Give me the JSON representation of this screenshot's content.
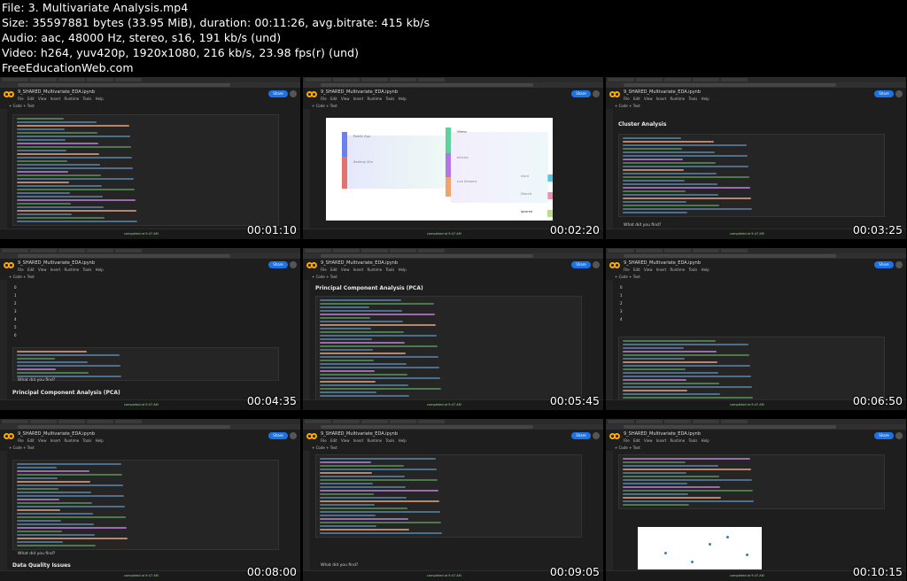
{
  "header": {
    "file": "File: 3. Multivariate Analysis.mp4",
    "size": "Size: 35597881 bytes (33.95 MiB), duration: 00:11:26, avg.bitrate: 415 kb/s",
    "audio": "Audio: aac, 48000 Hz, stereo, s16, 191 kb/s (und)",
    "video": "Video: h264, yuv420p, 1920x1080, 216 kb/s, 23.98 fps(r) (und)",
    "site": "FreeEducationWeb.com"
  },
  "colab": {
    "file_name": "9_SHARED_Multivariate_EDA.ipynb",
    "menu": "File Edit View Insert Runtime Tools Help",
    "share": "Share",
    "toolbar": "+ Code + Text",
    "status": "completed at 9:47 AM"
  },
  "thumbnails": [
    {
      "timestamp": "00:01:10",
      "section": ""
    },
    {
      "timestamp": "00:02:20",
      "section": ""
    },
    {
      "timestamp": "00:03:25",
      "section": "Cluster Analysis",
      "prompt": "What did you find?"
    },
    {
      "timestamp": "00:04:35",
      "section": "Principal Component Analysis (PCA)",
      "prompt": "What did you find?"
    },
    {
      "timestamp": "00:05:45",
      "section": "Principal Component Analysis (PCA)"
    },
    {
      "timestamp": "00:06:50",
      "section": ""
    },
    {
      "timestamp": "00:08:00",
      "section": "Data Quality Issues",
      "prompt": "What did you find?"
    },
    {
      "timestamp": "00:09:05",
      "section": "",
      "prompt": "What did you find?"
    },
    {
      "timestamp": "00:10:15",
      "section": ""
    }
  ],
  "sankey_labels": [
    "Mobile App",
    "Desktop Site",
    "Videos",
    "Articles",
    "Live Streams",
    "Liked",
    "Shared",
    "Ignored"
  ],
  "colors": {
    "colab_orange": "#f9ab00",
    "share_blue": "#1a73e8"
  }
}
